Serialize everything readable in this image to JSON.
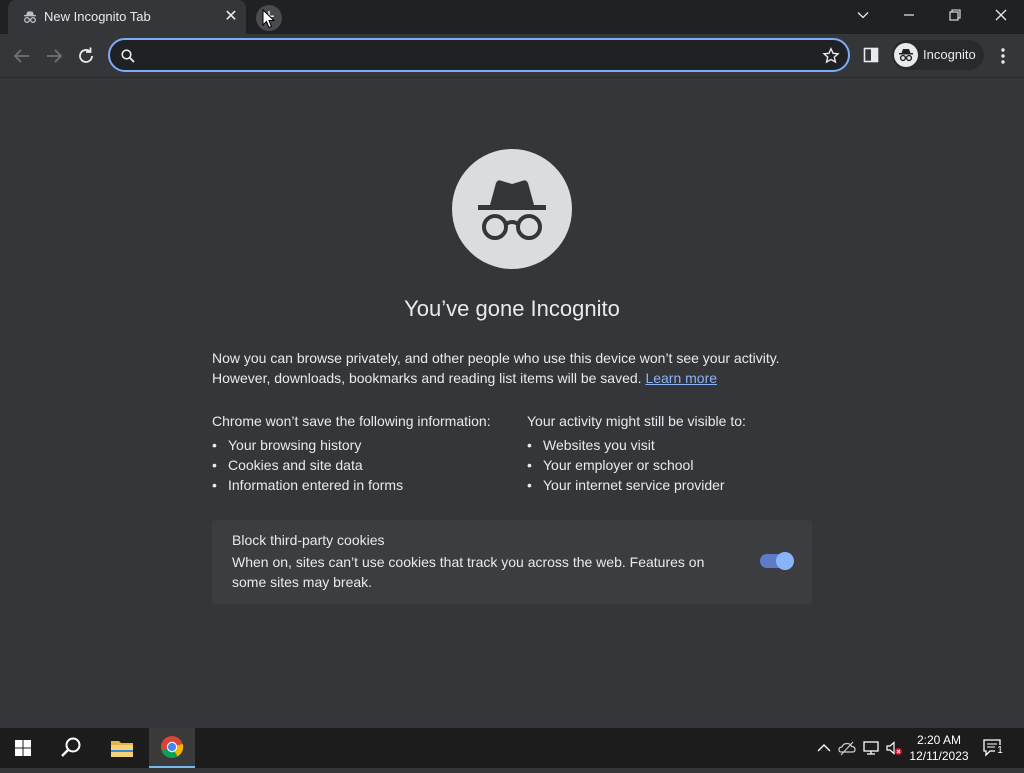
{
  "window": {
    "tab_title": "New Incognito Tab",
    "tab_close": "✕",
    "new_tab": "+"
  },
  "toolbar": {
    "omnibox_value": "",
    "profile_label": "Incognito"
  },
  "page": {
    "heading": "You’ve gone Incognito",
    "intro_line1": "Now you can browse privately, and other people who use this device won’t see your activity.",
    "intro_line2": "However, downloads, bookmarks and reading list items will be saved.",
    "learn_more": "Learn more",
    "left_column": {
      "heading": "Chrome won’t save the following information:",
      "items": [
        "Your browsing history",
        "Cookies and site data",
        "Information entered in forms"
      ]
    },
    "right_column": {
      "heading": "Your activity might still be visible to:",
      "items": [
        "Websites you visit",
        "Your employer or school",
        "Your internet service provider"
      ]
    },
    "cookies": {
      "title": "Block third-party cookies",
      "description": "When on, sites can’t use cookies that track you across the web. Features on some sites may break.",
      "enabled": true
    }
  },
  "taskbar": {
    "time": "2:20 AM",
    "date": "12/11/2023",
    "notification_count": "1"
  },
  "colors": {
    "accent": "#8ab4f8",
    "background": "#35363a",
    "titlebar": "#202124"
  }
}
